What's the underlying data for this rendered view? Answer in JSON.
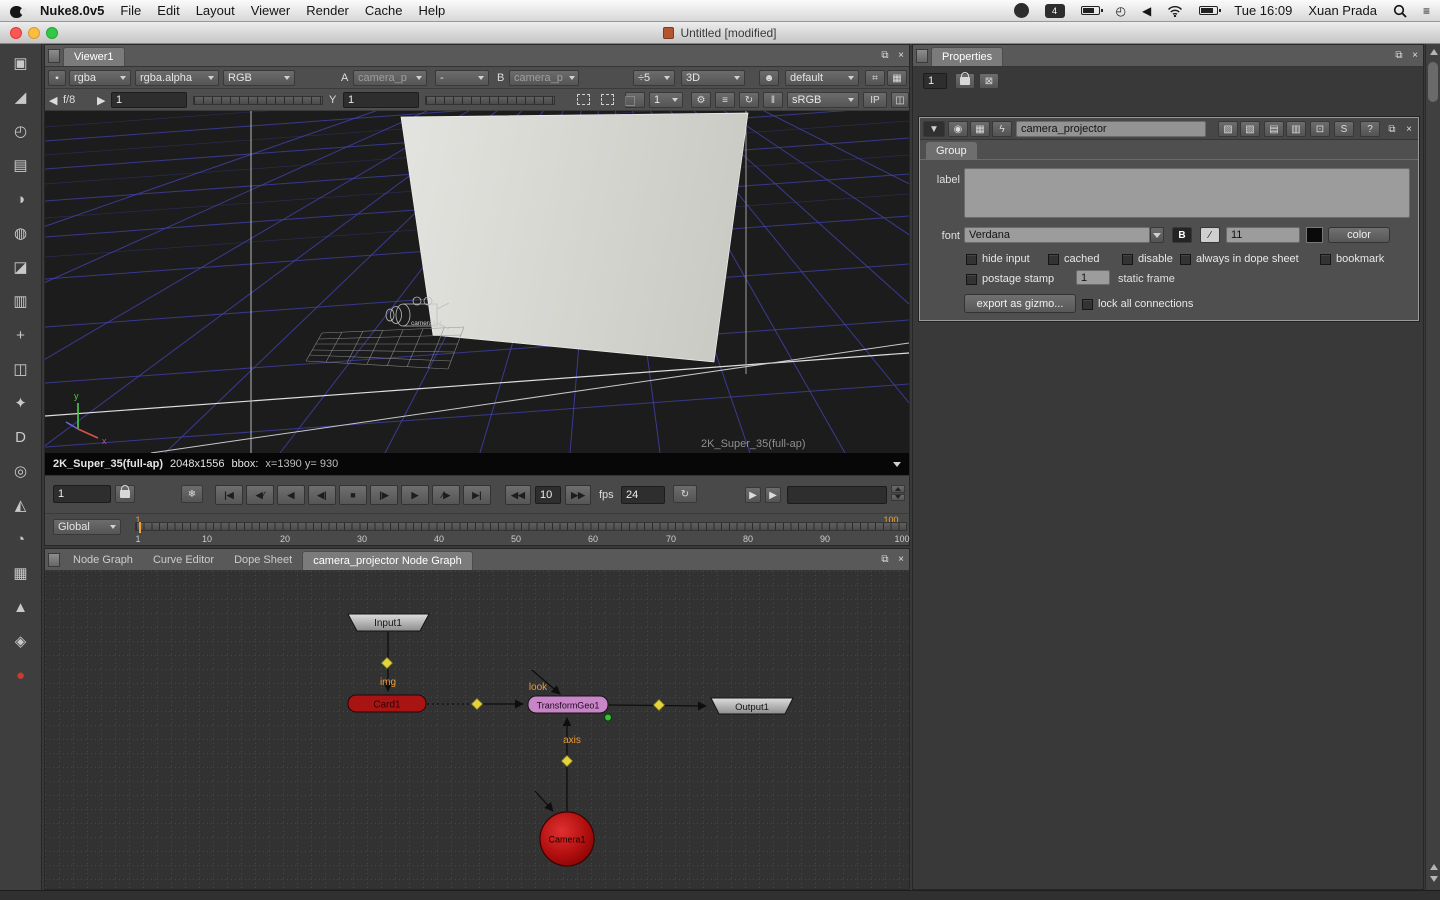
{
  "ui": {
    "float_glyph": "⧉",
    "close_glyph": "×"
  },
  "menubar": {
    "app_name": "Nuke8.0v5",
    "menus": [
      "File",
      "Edit",
      "Layout",
      "Viewer",
      "Render",
      "Cache",
      "Help"
    ],
    "input_badge": "4",
    "clock_glyph": "◴",
    "volume_glyph": "◀",
    "list_glyph": "≡",
    "time": "Tue 16:09",
    "user": "Xuan Prada"
  },
  "side_toolbar": {
    "items": [
      {
        "name": "image",
        "glyph": "▣"
      },
      {
        "name": "draw",
        "glyph": "◢"
      },
      {
        "name": "time",
        "glyph": "◴"
      },
      {
        "name": "channel",
        "glyph": "▤"
      },
      {
        "name": "color",
        "glyph": "◑"
      },
      {
        "name": "filter",
        "glyph": "◍"
      },
      {
        "name": "keyer",
        "glyph": "◪"
      },
      {
        "name": "merge",
        "glyph": "▥"
      },
      {
        "name": "transform",
        "glyph": "+"
      },
      {
        "name": "threed",
        "glyph": "◫"
      },
      {
        "name": "particles",
        "glyph": "✦"
      },
      {
        "name": "deep",
        "glyph": "D"
      },
      {
        "name": "views",
        "glyph": "◎"
      },
      {
        "name": "metadata",
        "glyph": "◭"
      },
      {
        "name": "toolsets",
        "glyph": "◔"
      },
      {
        "name": "other",
        "glyph": "▦"
      },
      {
        "name": "furnace",
        "glyph": "▲"
      },
      {
        "name": "plugins",
        "glyph": "◈"
      },
      {
        "name": "ofx",
        "glyph": "●"
      }
    ]
  },
  "viewer": {
    "tab": "Viewer1",
    "row1": {
      "layer": "rgba",
      "alpha": "rgba.alpha",
      "display": "RGB",
      "a": "A",
      "a_value": "camera_p",
      "wipe": "-",
      "b": "B",
      "b_value": "camera_p",
      "scale": "÷5",
      "mode": "3D",
      "person_glyph": "☻",
      "view": "default"
    },
    "row2": {
      "prev_glyph": "◀",
      "fstop": "f/8",
      "next_glyph": "▶",
      "gain": "1",
      "gamma_label": "Y",
      "gamma": "1",
      "downres": "1",
      "gear_glyph": "⚙",
      "menu_glyph": "≡",
      "refresh_glyph": "↻",
      "pause_glyph": "‖",
      "lut": "sRGB",
      "ip": "IP"
    },
    "viewport": {
      "camera_label": "camera1_f",
      "format_label": "2K_Super_35(full-ap)",
      "axis_y": "y",
      "axis_x": "x"
    },
    "info": {
      "format": "2K_Super_35(full-ap)",
      "resolution": "2048x1556",
      "bbox_label": "bbox:",
      "coords": "x=1390 y= 930"
    },
    "playback": {
      "frame": "1",
      "snow_glyph": "❄",
      "transport": [
        "|◀",
        "◀⁄",
        "◀",
        "◀|",
        "■",
        "|▶",
        "▶",
        "⁄▶",
        "▶|"
      ],
      "jump_back": "◀◀",
      "inc": "10",
      "jump_fwd": "▶▶",
      "fps_label": "fps",
      "fps": "24",
      "loop_glyph": "↻",
      "mini_play": "▶"
    },
    "timeline": {
      "range": "Global",
      "current": "1",
      "end": "100",
      "ticks": [
        "1",
        "10",
        "20",
        "30",
        "40",
        "50",
        "60",
        "70",
        "80",
        "90",
        "100"
      ]
    }
  },
  "nodegraph": {
    "tabs": [
      {
        "label": "Node Graph"
      },
      {
        "label": "Curve Editor"
      },
      {
        "label": "Dope Sheet"
      },
      {
        "label": "camera_projector Node Graph"
      }
    ],
    "nodes": {
      "input": "Input1",
      "card": "Card1",
      "transform": "TransformGeo1",
      "output": "Output1",
      "camera": "Camera1"
    },
    "edge_labels": {
      "img": "img",
      "look": "look",
      "axis": "axis"
    }
  },
  "properties": {
    "tab": "Properties",
    "toprow": {
      "count": "1",
      "clear_glyph": "⊠"
    },
    "header_icons": [
      {
        "name": "collapse",
        "glyph": "▼"
      },
      {
        "name": "center-node",
        "glyph": "◉"
      },
      {
        "name": "postage",
        "glyph": "▦"
      },
      {
        "name": "expression",
        "glyph": "ϟ"
      }
    ],
    "node_name": "camera_projector",
    "right_icons": [
      {
        "name": "store-a",
        "glyph": "▨"
      },
      {
        "name": "store-b",
        "glyph": "▧"
      },
      {
        "name": "undo",
        "glyph": "▤"
      },
      {
        "name": "redo",
        "glyph": "▥"
      },
      {
        "name": "copy",
        "glyph": "⊡"
      },
      {
        "name": "script",
        "glyph": "S"
      },
      {
        "name": "help",
        "glyph": "?"
      },
      {
        "name": "float",
        "glyph": "⧉"
      },
      {
        "name": "close",
        "glyph": "×"
      }
    ],
    "group_tab": "Group",
    "label_label": "label",
    "label_value": "",
    "font_label": "font",
    "font_family": "Verdana",
    "bold_glyph": "B",
    "italic_glyph": "∕",
    "font_size": "11",
    "color_button": "color",
    "checkboxes": {
      "hide_input": "hide input",
      "cached": "cached",
      "disable": "disable",
      "dope": "always in dope sheet",
      "bookmark": "bookmark",
      "postage": "postage stamp",
      "lock": "lock all connections"
    },
    "static_frame_value": "1",
    "static_frame_label": "static frame",
    "export_button": "export as gizmo..."
  }
}
